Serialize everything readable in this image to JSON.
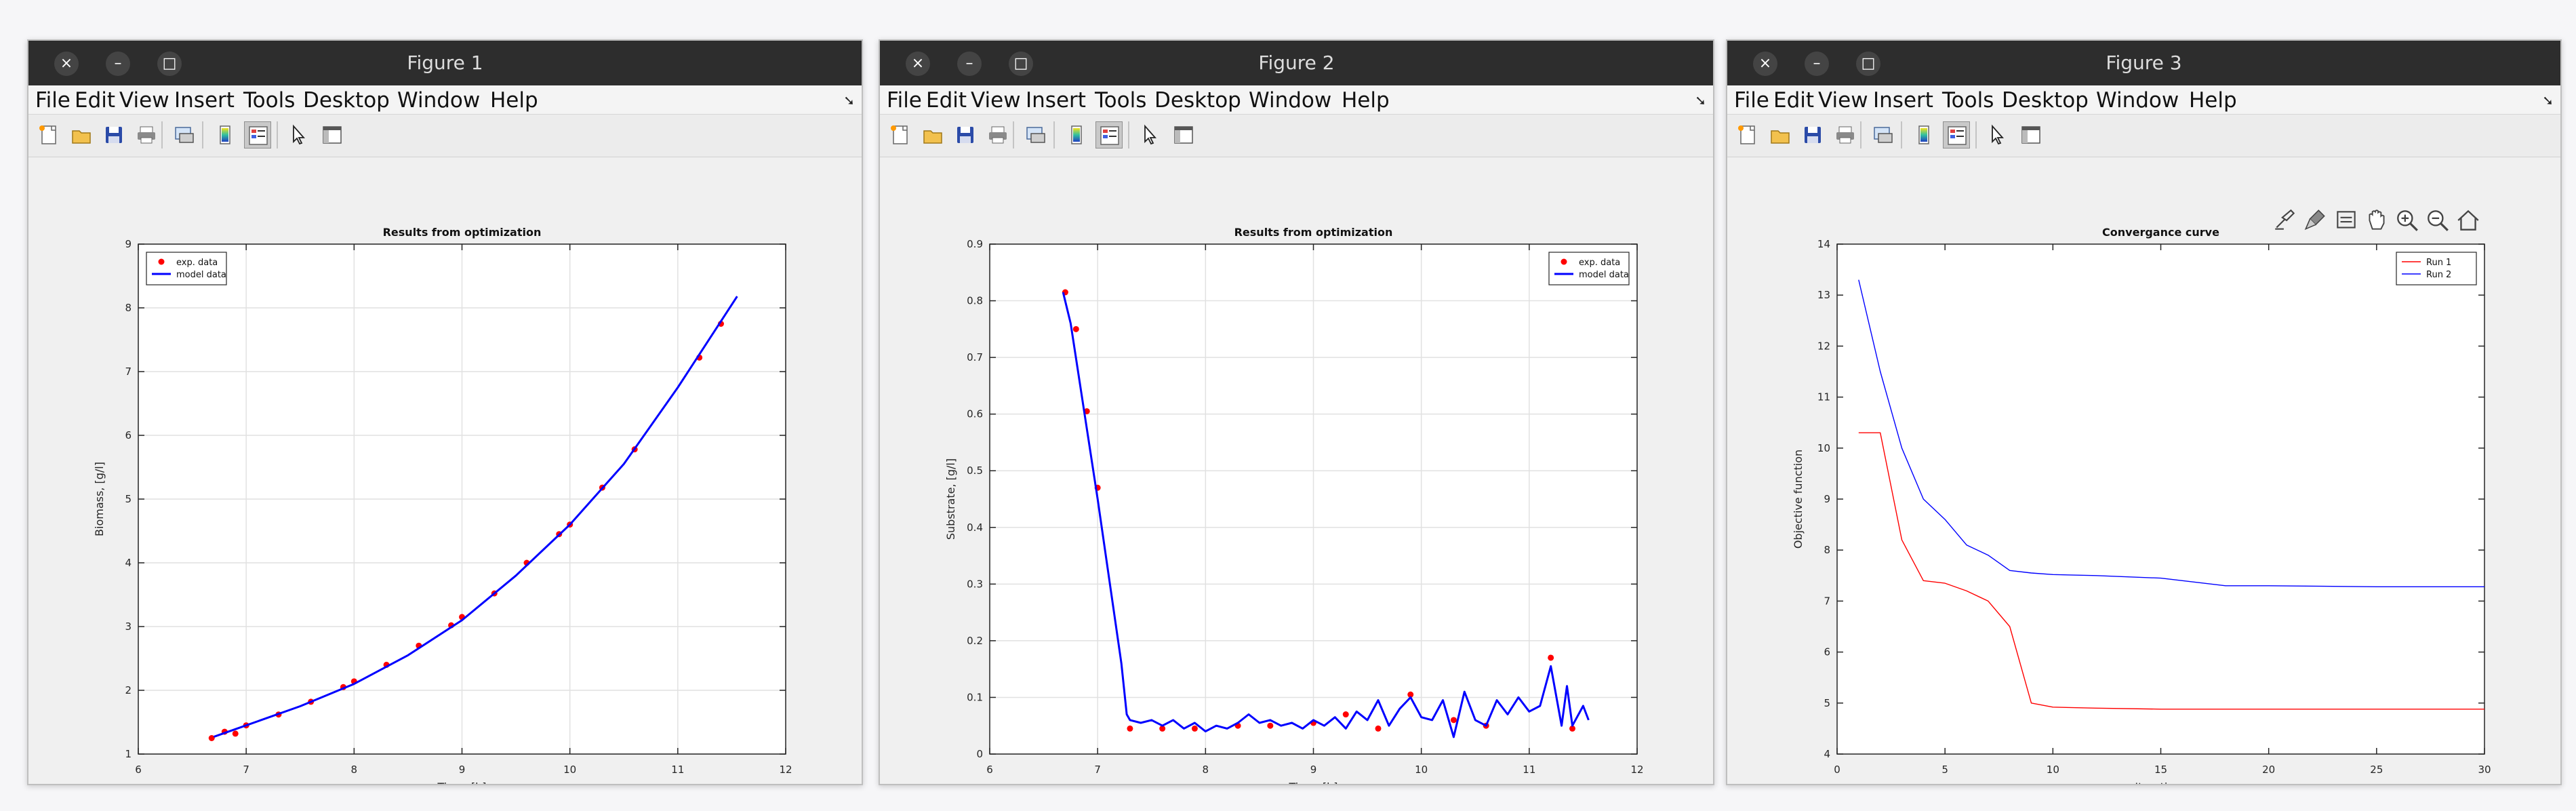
{
  "menu": [
    "File",
    "Edit",
    "View",
    "Insert",
    "Tools",
    "Desktop",
    "Window",
    "Help"
  ],
  "figures": [
    {
      "title": "Figure 1",
      "chart_data": {
        "type": "scatter+line",
        "title": "Results from optimization",
        "xlabel": "Time, [h]",
        "ylabel": "Biomass, [g/l]",
        "xlim": [
          6,
          12
        ],
        "ylim": [
          1,
          9
        ],
        "xticks": [
          6,
          7,
          8,
          9,
          10,
          11,
          12
        ],
        "yticks": [
          1,
          2,
          3,
          4,
          5,
          6,
          7,
          8,
          9
        ],
        "grid": true,
        "legend_position": "top-left",
        "series": [
          {
            "name": "exp. data",
            "kind": "markers",
            "color": "#ff0000",
            "x": [
              6.68,
              6.8,
              6.9,
              7.0,
              7.3,
              7.6,
              7.9,
              8.0,
              8.3,
              8.6,
              8.9,
              9.0,
              9.3,
              9.6,
              9.9,
              10.0,
              10.3,
              10.6,
              11.2,
              11.4
            ],
            "y": [
              1.25,
              1.35,
              1.32,
              1.45,
              1.62,
              1.82,
              2.05,
              2.14,
              2.4,
              2.7,
              3.02,
              3.15,
              3.52,
              4.0,
              4.45,
              4.6,
              5.18,
              5.78,
              7.22,
              7.75
            ]
          },
          {
            "name": "model data",
            "kind": "line",
            "color": "#0000ff",
            "x": [
              6.7,
              7.0,
              7.5,
              8.0,
              8.5,
              9.0,
              9.5,
              10.0,
              10.5,
              11.0,
              11.55
            ],
            "y": [
              1.27,
              1.45,
              1.75,
              2.1,
              2.55,
              3.1,
              3.8,
              4.6,
              5.55,
              6.75,
              8.18
            ]
          }
        ]
      }
    },
    {
      "title": "Figure 2",
      "chart_data": {
        "type": "scatter+line",
        "title": "Results from optimization",
        "xlabel": "Time, [h]",
        "ylabel": "Substrate, [g/l]",
        "xlim": [
          6,
          12
        ],
        "ylim": [
          0,
          0.9
        ],
        "xticks": [
          6,
          7,
          8,
          9,
          10,
          11,
          12
        ],
        "yticks": [
          0,
          0.1,
          0.2,
          0.3,
          0.4,
          0.5,
          0.6,
          0.7,
          0.8,
          0.9
        ],
        "grid": true,
        "legend_position": "top-right",
        "series": [
          {
            "name": "exp. data",
            "kind": "markers",
            "color": "#ff0000",
            "x": [
              6.7,
              6.8,
              6.9,
              7.0,
              7.3,
              7.6,
              7.9,
              8.3,
              8.6,
              9.0,
              9.3,
              9.6,
              9.9,
              10.3,
              10.6,
              11.2,
              11.4
            ],
            "y": [
              0.815,
              0.75,
              0.605,
              0.47,
              0.045,
              0.045,
              0.045,
              0.05,
              0.05,
              0.055,
              0.07,
              0.045,
              0.105,
              0.06,
              0.05,
              0.17,
              0.045
            ]
          },
          {
            "name": "model data",
            "kind": "line",
            "color": "#0000ff",
            "x": [
              6.68,
              6.75,
              7.0,
              7.22,
              7.27,
              7.3,
              7.4,
              7.5,
              7.6,
              7.7,
              7.8,
              7.9,
              8.0,
              8.1,
              8.2,
              8.3,
              8.4,
              8.5,
              8.6,
              8.7,
              8.8,
              8.9,
              9.0,
              9.1,
              9.2,
              9.3,
              9.4,
              9.5,
              9.6,
              9.7,
              9.8,
              9.9,
              10.0,
              10.1,
              10.2,
              10.3,
              10.4,
              10.5,
              10.6,
              10.7,
              10.8,
              10.9,
              11.0,
              11.1,
              11.2,
              11.3,
              11.35,
              11.4,
              11.5,
              11.55
            ],
            "y": [
              0.815,
              0.76,
              0.45,
              0.16,
              0.07,
              0.06,
              0.055,
              0.06,
              0.05,
              0.06,
              0.045,
              0.055,
              0.04,
              0.05,
              0.045,
              0.055,
              0.07,
              0.055,
              0.06,
              0.05,
              0.055,
              0.045,
              0.06,
              0.05,
              0.065,
              0.045,
              0.075,
              0.06,
              0.095,
              0.05,
              0.08,
              0.1,
              0.065,
              0.06,
              0.095,
              0.03,
              0.11,
              0.06,
              0.05,
              0.095,
              0.07,
              0.1,
              0.075,
              0.085,
              0.155,
              0.05,
              0.12,
              0.05,
              0.085,
              0.06
            ]
          }
        ]
      }
    },
    {
      "title": "Figure 3",
      "chart_data": {
        "type": "line",
        "title": "Convergance curve",
        "xlabel": "Iterations",
        "ylabel": "Objective function",
        "xlim": [
          0,
          30
        ],
        "ylim": [
          4,
          14
        ],
        "xticks": [
          0,
          5,
          10,
          15,
          20,
          25,
          30
        ],
        "yticks": [
          4,
          5,
          6,
          7,
          8,
          9,
          10,
          11,
          12,
          13,
          14
        ],
        "grid": false,
        "legend_position": "top-right",
        "series": [
          {
            "name": "Run 1",
            "color": "#ff0000",
            "x": [
              1,
              2,
              3,
              4,
              5,
              6,
              7,
              8,
              9,
              10,
              12,
              15,
              20,
              25,
              30
            ],
            "y": [
              10.3,
              10.3,
              8.2,
              7.4,
              7.35,
              7.2,
              7.0,
              6.5,
              5.0,
              4.92,
              4.9,
              4.88,
              4.88,
              4.88,
              4.88
            ]
          },
          {
            "name": "Run 2",
            "color": "#0000ff",
            "x": [
              1,
              2,
              3,
              4,
              5,
              6,
              7,
              8,
              9,
              10,
              12,
              15,
              18,
              20,
              25,
              30
            ],
            "y": [
              13.3,
              11.5,
              10.0,
              9.0,
              8.6,
              8.1,
              7.9,
              7.6,
              7.55,
              7.52,
              7.5,
              7.45,
              7.3,
              7.3,
              7.28,
              7.28
            ]
          }
        ]
      }
    }
  ]
}
